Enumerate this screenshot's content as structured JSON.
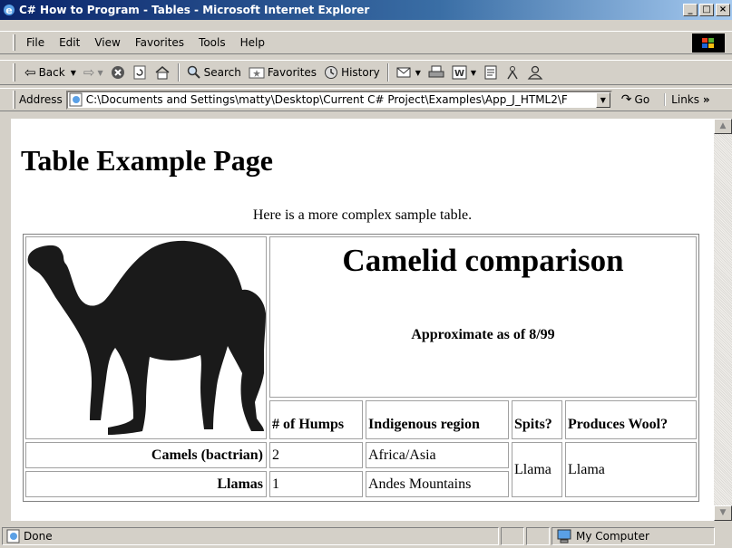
{
  "window": {
    "title": "C# How to Program - Tables - Microsoft Internet Explorer",
    "minimize": "_",
    "maximize": "□",
    "close": "×"
  },
  "menu": [
    "File",
    "Edit",
    "View",
    "Favorites",
    "Tools",
    "Help"
  ],
  "toolbar": {
    "back": "Back",
    "search": "Search",
    "favorites": "Favorites",
    "history": "History"
  },
  "address": {
    "label": "Address",
    "url": "C:\\Documents and Settings\\matty\\Desktop\\Current C# Project\\Examples\\App_J_HTML2\\F",
    "go": "Go",
    "links": "Links"
  },
  "page": {
    "heading": "Table Example Page",
    "intro": "Here is a more complex sample table.",
    "table": {
      "caption": "Camelid comparison",
      "subcaption": "Approximate as of 8/99",
      "headers": [
        "# of Humps",
        "Indigenous region",
        "Spits?",
        "Produces Wool?"
      ],
      "rows": [
        {
          "name": "Camels (bactrian)",
          "humps": "2",
          "region": "Africa/Asia"
        },
        {
          "name": "Llamas",
          "humps": "1",
          "region": "Andes Mountains"
        }
      ],
      "spits": "Llama",
      "wool": "Llama"
    }
  },
  "status": {
    "text": "Done",
    "zone": "My Computer"
  },
  "colors": {
    "titlebar_start": "#0a246a",
    "titlebar_end": "#a6caf0",
    "chrome": "#d4d0c8"
  }
}
